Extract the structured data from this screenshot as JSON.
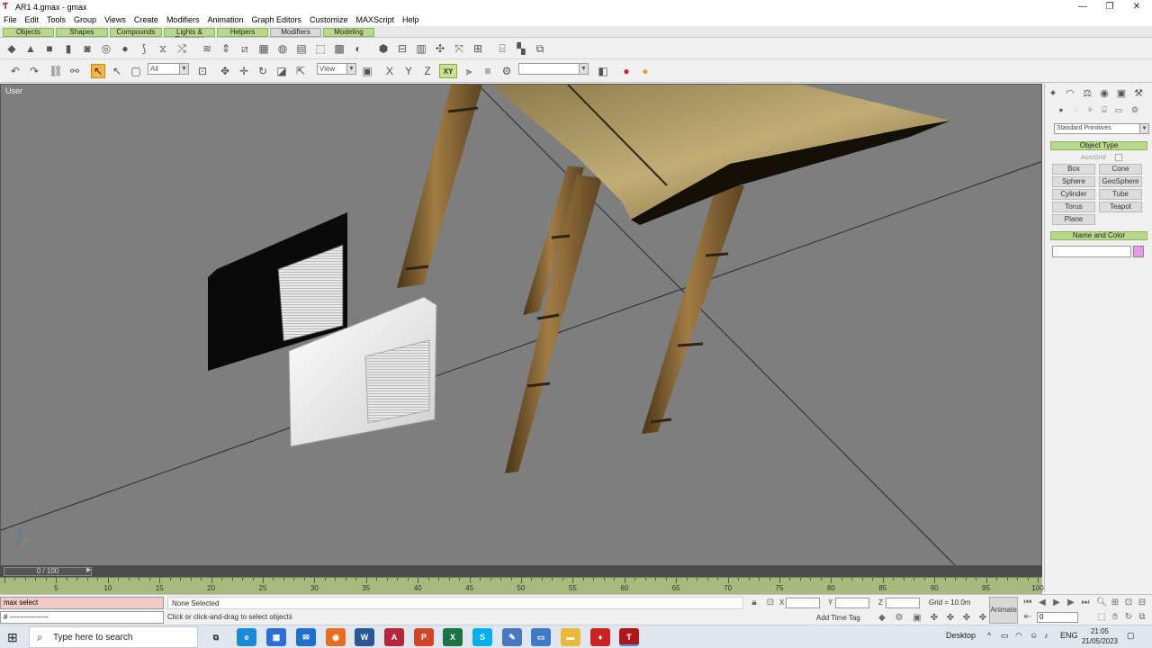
{
  "window": {
    "title": "AR1 4.gmax - gmax",
    "min_glyph": "—",
    "max_glyph": "❐",
    "close_glyph": "✕"
  },
  "menu": [
    "File",
    "Edit",
    "Tools",
    "Group",
    "Views",
    "Create",
    "Modifiers",
    "Animation",
    "Graph Editors",
    "Customize",
    "MAXScript",
    "Help"
  ],
  "tabs": [
    "Objects",
    "Shapes",
    "Compounds",
    "Lights & Cameras",
    "Helpers",
    "Modifiers",
    "Modeling"
  ],
  "active_tab": "Modifiers",
  "toolbar2": {
    "selection_filter": "All",
    "ref_coord": "View",
    "named_sel": "",
    "constraint": "XY"
  },
  "viewport": {
    "label": "User"
  },
  "command_panel": {
    "category_dropdown": "Standard Primitives",
    "object_type_header": "Object Type",
    "autogrid_label": "AutoGrid",
    "primitives": [
      "Box",
      "Cone",
      "Sphere",
      "GeoSphere",
      "Cylinder",
      "Tube",
      "Torus",
      "Teapot",
      "Plane"
    ],
    "name_color_header": "Name and Color",
    "object_name": "",
    "object_color": "#e89ae8"
  },
  "timeline": {
    "slider_label": "0 / 100",
    "frame_current": 0,
    "frame_total": 100,
    "tick_labels": [
      "5",
      "10",
      "15",
      "20",
      "25",
      "30",
      "35",
      "40",
      "45",
      "50",
      "55",
      "60",
      "65",
      "70",
      "75",
      "80",
      "85",
      "90",
      "95",
      "100"
    ]
  },
  "status": {
    "listener_line1": "max select",
    "listener_line2": "# ----------------",
    "selection": "None Selected",
    "prompt": "Click or click-and-drag to select objects",
    "x_label": "X",
    "y_label": "Y",
    "z_label": "Z",
    "grid": "Grid = 10.0m",
    "add_time_tag": "Add Time Tag",
    "animate": "Animate",
    "frame_field": "0"
  },
  "taskbar": {
    "search_placeholder": "Type here to search",
    "desktop_label": "Desktop",
    "language": "ENG",
    "time": "21:05",
    "date": "21/05/2023"
  }
}
